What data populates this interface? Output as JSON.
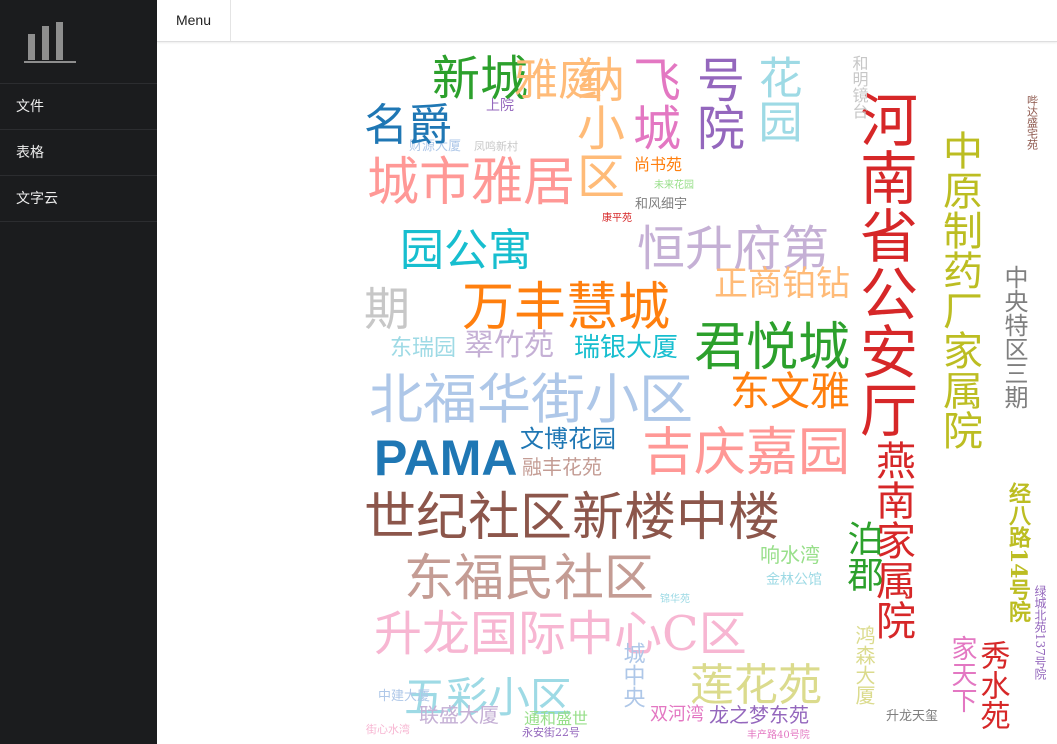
{
  "sidebar": {
    "logo_icon": "bar-chart-icon",
    "items": [
      {
        "id": "file",
        "label": "文件"
      },
      {
        "id": "table",
        "label": "表格"
      },
      {
        "id": "wordcloud",
        "label": "文字云"
      }
    ]
  },
  "topbar": {
    "menu_label": "Menu"
  },
  "wordcloud": {
    "words": [
      {
        "text": "河南省公安厅",
        "color": "#d62728",
        "vertical": true
      },
      {
        "text": "中原制药厂家属院",
        "color": "#bcbd22",
        "vertical": true
      },
      {
        "text": "燕南家属院",
        "color": "#d62728",
        "vertical": true
      },
      {
        "text": "中央特区三期",
        "color": "#7f7f7f",
        "vertical": true
      },
      {
        "text": "经八路14号院",
        "color": "#bcbd22",
        "vertical": true
      },
      {
        "text": "秀水苑",
        "color": "#d62728",
        "vertical": true
      },
      {
        "text": "家天下",
        "color": "#e377c2",
        "vertical": true
      },
      {
        "text": "泊郡",
        "color": "#2ca02c",
        "vertical": true
      },
      {
        "text": "鸿森大厦",
        "color": "#dbdb8d",
        "vertical": true
      },
      {
        "text": "绿城北苑137号院",
        "color": "#9467bd",
        "vertical": true
      },
      {
        "text": "哔达盛宅苑",
        "color": "#8c564b",
        "vertical": true
      },
      {
        "text": "升龙天玺",
        "color": "#7f7f7f",
        "vertical": false
      },
      {
        "text": "新城",
        "color": "#2ca02c",
        "vertical": false
      },
      {
        "text": "雅庭",
        "color": "#ffbb78",
        "vertical": false
      },
      {
        "text": "城市雅居",
        "color": "#ff9896",
        "vertical": false
      },
      {
        "text": "恒升府第",
        "color": "#c5b0d5",
        "vertical": false
      },
      {
        "text": "园公寓",
        "color": "#17becf",
        "vertical": false
      },
      {
        "text": "万丰慧城",
        "color": "#ff7f0e",
        "vertical": false
      },
      {
        "text": "正商铂钻",
        "color": "#ffbb78",
        "vertical": false
      },
      {
        "text": "君悦城",
        "color": "#2ca02c",
        "vertical": false
      },
      {
        "text": "东瑞园",
        "color": "#9edae5",
        "vertical": false
      },
      {
        "text": "翠竹苑",
        "color": "#c5b0d5",
        "vertical": false
      },
      {
        "text": "瑞银大厦",
        "color": "#17becf",
        "vertical": false
      },
      {
        "text": "北福华街小区",
        "color": "#aec7e8",
        "vertical": false
      },
      {
        "text": "东文雅",
        "color": "#ff7f0e",
        "vertical": false
      },
      {
        "text": "PAMA",
        "color": "#1f77b4",
        "vertical": false
      },
      {
        "text": "文博花园",
        "color": "#1f77b4",
        "vertical": false
      },
      {
        "text": "融丰花苑",
        "color": "#c49c94",
        "vertical": false
      },
      {
        "text": "吉庆嘉园",
        "color": "#ff9896",
        "vertical": false
      },
      {
        "text": "世纪社区新楼中楼",
        "color": "#8c564b",
        "vertical": false
      },
      {
        "text": "东福民社区",
        "color": "#c49c94",
        "vertical": false
      },
      {
        "text": "响水湾",
        "color": "#98df8a",
        "vertical": false
      },
      {
        "text": "金林公馆",
        "color": "#9edae5",
        "vertical": false
      },
      {
        "text": "升龙国际中心C区",
        "color": "#f7b6d2",
        "vertical": false
      },
      {
        "text": "五彩小区",
        "color": "#9edae5",
        "vertical": false
      },
      {
        "text": "莲花苑",
        "color": "#dbdb8d",
        "vertical": false
      },
      {
        "text": "联盛大厦",
        "color": "#c5b0d5",
        "vertical": false
      },
      {
        "text": "通和盛世",
        "color": "#98df8a",
        "vertical": false
      },
      {
        "text": "龙之梦东苑",
        "color": "#9467bd",
        "vertical": false
      },
      {
        "text": "双河湾",
        "color": "#e377c2",
        "vertical": false
      },
      {
        "text": "城中央",
        "color": "#aec7e8",
        "vertical": true
      },
      {
        "text": "尚书苑",
        "color": "#ff7f0e",
        "vertical": false
      },
      {
        "text": "和风细宇",
        "color": "#7f7f7f",
        "vertical": false
      },
      {
        "text": "未来花园",
        "color": "#98df8a",
        "vertical": false
      },
      {
        "text": "康平苑",
        "color": "#d62728",
        "vertical": false
      },
      {
        "text": "中建大厦",
        "color": "#aec7e8",
        "vertical": false
      },
      {
        "text": "锦华苑",
        "color": "#9edae5",
        "vertical": false
      },
      {
        "text": "永安街22号",
        "color": "#9467bd",
        "vertical": false
      },
      {
        "text": "丰产路40号院",
        "color": "#e377c2",
        "vertical": false
      },
      {
        "text": "街心水湾",
        "color": "#f7b6d2",
        "vertical": false
      },
      {
        "text": "财源大厦",
        "color": "#aec7e8",
        "vertical": false
      },
      {
        "text": "凤鸣新村",
        "color": "#c7c7c7",
        "vertical": false
      },
      {
        "text": "上院",
        "color": "#9467bd",
        "vertical": false
      },
      {
        "text": "和明镜台",
        "color": "#c7c7c7",
        "vertical": true
      },
      {
        "text": "花园",
        "color": "#9edae5",
        "vertical": true
      },
      {
        "text": "号院",
        "color": "#9467bd",
        "vertical": true
      },
      {
        "text": "飞城",
        "color": "#e377c2",
        "vertical": true
      },
      {
        "text": "纳小区",
        "color": "#ffbb78",
        "vertical": true
      },
      {
        "text": "期",
        "color": "#c7c7c7",
        "vertical": false
      },
      {
        "text": "名爵",
        "color": "#1f77b4",
        "vertical": false
      }
    ]
  }
}
